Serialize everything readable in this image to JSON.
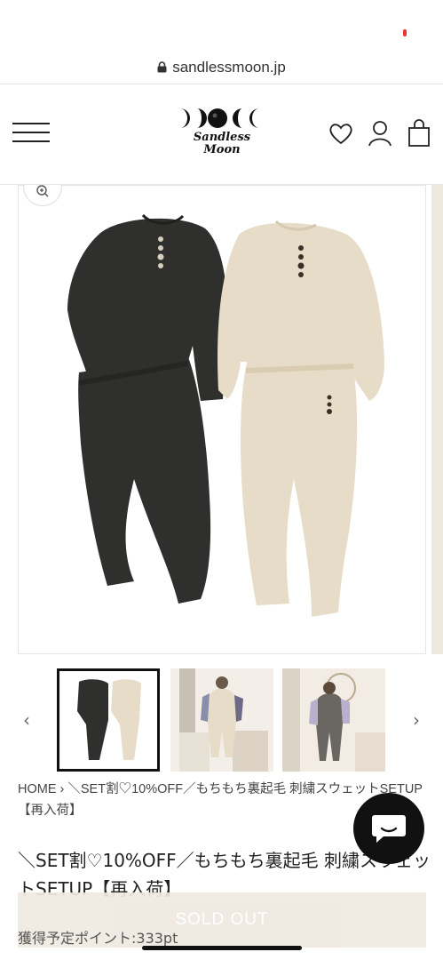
{
  "browser": {
    "url": "sandlessmoon.jp"
  },
  "header": {
    "logo_line1": "Sandless",
    "logo_line2": "Moon"
  },
  "gallery": {
    "thumbnails": [
      {
        "alt": "Black and beige setup"
      },
      {
        "alt": "Model wearing beige setup"
      },
      {
        "alt": "Model wearing grey setup"
      }
    ],
    "prev_arrow": "‹",
    "next_arrow": "›"
  },
  "breadcrumb": {
    "home": "HOME",
    "separator": " › ",
    "current": "＼SET割♡10%OFF／もちもち裏起毛 刺繍スウェットSETUP【再入荷】"
  },
  "product": {
    "title": "＼SET割♡10%OFF／もちもち裏起毛 刺繍スウェットSETUP【再入荷】",
    "sold_out_label": "SOLD OUT",
    "points_label": "獲得予定ポイント:333pt"
  },
  "colors": {
    "black_garment": "#2f302d",
    "beige_garment": "#e7dcc8",
    "sold_out_bg": "#efe9e1"
  }
}
